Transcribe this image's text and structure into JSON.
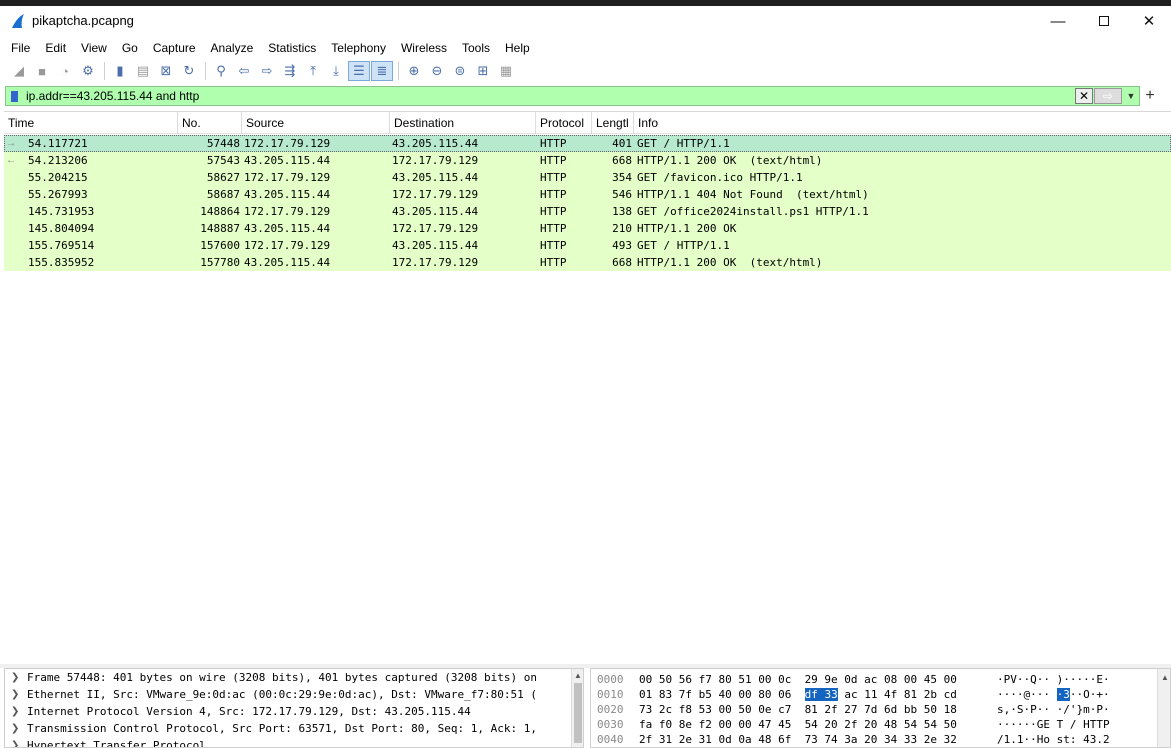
{
  "window": {
    "title": "pikaptcha.pcapng",
    "controls": {
      "minimize": "—",
      "close": "✕"
    }
  },
  "menu": [
    "File",
    "Edit",
    "View",
    "Go",
    "Capture",
    "Analyze",
    "Statistics",
    "Telephony",
    "Wireless",
    "Tools",
    "Help"
  ],
  "toolbar": {
    "icons": [
      {
        "name": "start-capture-icon",
        "glyph": "◢",
        "dim": true
      },
      {
        "name": "stop-capture-icon",
        "glyph": "■",
        "dim": true
      },
      {
        "name": "restart-capture-icon",
        "glyph": "◔",
        "dim": true
      },
      {
        "name": "capture-options-icon",
        "glyph": "⚙",
        "dim": false
      },
      {
        "sep": true
      },
      {
        "name": "open-file-icon",
        "glyph": "▮",
        "dim": false
      },
      {
        "name": "save-file-icon",
        "glyph": "▤",
        "dim": true
      },
      {
        "name": "close-file-icon",
        "glyph": "⊠",
        "dim": false
      },
      {
        "name": "reload-file-icon",
        "glyph": "↻",
        "dim": false
      },
      {
        "sep": true
      },
      {
        "name": "find-packet-icon",
        "glyph": "⚲",
        "dim": false
      },
      {
        "name": "go-back-icon",
        "glyph": "⇦",
        "dim": false
      },
      {
        "name": "go-forward-icon",
        "glyph": "⇨",
        "dim": false
      },
      {
        "name": "go-to-packet-icon",
        "glyph": "⇶",
        "dim": false
      },
      {
        "name": "go-first-icon",
        "glyph": "⤒",
        "dim": false
      },
      {
        "name": "go-last-icon",
        "glyph": "⤓",
        "dim": false
      },
      {
        "name": "autoscroll-icon",
        "glyph": "☰",
        "dim": false,
        "active": true
      },
      {
        "name": "colorize-icon",
        "glyph": "≣",
        "dim": false,
        "active": true
      },
      {
        "sep": true
      },
      {
        "name": "zoom-in-icon",
        "glyph": "⊕",
        "dim": false
      },
      {
        "name": "zoom-out-icon",
        "glyph": "⊖",
        "dim": false
      },
      {
        "name": "zoom-normal-icon",
        "glyph": "⊜",
        "dim": false
      },
      {
        "name": "resize-columns-icon",
        "glyph": "⊞",
        "dim": false
      },
      {
        "name": "layout-icon",
        "glyph": "▦",
        "dim": true
      }
    ]
  },
  "filter": {
    "value": "ip.addr==43.205.115.44 and http",
    "apply_glyph": "⇨",
    "add_glyph": "+"
  },
  "columns": [
    "Time",
    "No.",
    "Source",
    "Destination",
    "Protocol",
    "Lengtl",
    "Info"
  ],
  "packets": [
    {
      "time": "54.117721",
      "no": "57448",
      "src": "172.17.79.129",
      "dst": "43.205.115.44",
      "proto": "HTTP",
      "len": "401",
      "info": "GET / HTTP/1.1",
      "selected": true,
      "rel": "→"
    },
    {
      "time": "54.213206",
      "no": "57543",
      "src": "43.205.115.44",
      "dst": "172.17.79.129",
      "proto": "HTTP",
      "len": "668",
      "info": "HTTP/1.1 200 OK  (text/html)",
      "rel": "←"
    },
    {
      "time": "55.204215",
      "no": "58627",
      "src": "172.17.79.129",
      "dst": "43.205.115.44",
      "proto": "HTTP",
      "len": "354",
      "info": "GET /favicon.ico HTTP/1.1",
      "rel": ""
    },
    {
      "time": "55.267993",
      "no": "58687",
      "src": "43.205.115.44",
      "dst": "172.17.79.129",
      "proto": "HTTP",
      "len": "546",
      "info": "HTTP/1.1 404 Not Found  (text/html)",
      "rel": ""
    },
    {
      "time": "145.731953",
      "no": "148864",
      "src": "172.17.79.129",
      "dst": "43.205.115.44",
      "proto": "HTTP",
      "len": "138",
      "info": "GET /office2024install.ps1 HTTP/1.1",
      "rel": ""
    },
    {
      "time": "145.804094",
      "no": "148887",
      "src": "43.205.115.44",
      "dst": "172.17.79.129",
      "proto": "HTTP",
      "len": "210",
      "info": "HTTP/1.1 200 OK",
      "rel": ""
    },
    {
      "time": "155.769514",
      "no": "157600",
      "src": "172.17.79.129",
      "dst": "43.205.115.44",
      "proto": "HTTP",
      "len": "493",
      "info": "GET / HTTP/1.1",
      "rel": ""
    },
    {
      "time": "155.835952",
      "no": "157780",
      "src": "43.205.115.44",
      "dst": "172.17.79.129",
      "proto": "HTTP",
      "len": "668",
      "info": "HTTP/1.1 200 OK  (text/html)",
      "rel": ""
    }
  ],
  "details": [
    "Frame 57448: 401 bytes on wire (3208 bits), 401 bytes captured (3208 bits) on",
    "Ethernet II, Src: VMware_9e:0d:ac (00:0c:29:9e:0d:ac), Dst: VMware_f7:80:51 (",
    "Internet Protocol Version 4, Src: 172.17.79.129, Dst: 43.205.115.44",
    "Transmission Control Protocol, Src Port: 63571, Dst Port: 80, Seq: 1, Ack: 1,",
    "Hypertext Transfer Protocol"
  ],
  "hexdump": [
    {
      "off": "0000",
      "hex_a": "00 50 56 f7 80 51 00 0c  29 9e 0d ac 08 00 45 00",
      "hex_b": "",
      "hex_c": "",
      "asc_a": "·PV··Q·· )·····E·",
      "asc_b": "",
      "asc_c": ""
    },
    {
      "off": "0010",
      "hex_a": "01 83 7f b5 40 00 80 06  ",
      "hex_b": "df 33",
      "hex_c": " ac 11 4f 81 2b cd",
      "asc_a": "····@··· ",
      "asc_b": "·3",
      "asc_c": "··O·+·"
    },
    {
      "off": "0020",
      "hex_a": "73 2c f8 53 00 50 0e c7  81 2f 27 7d 6d bb 50 18",
      "hex_b": "",
      "hex_c": "",
      "asc_a": "s,·S·P·· ·/'}m·P·",
      "asc_b": "",
      "asc_c": ""
    },
    {
      "off": "0030",
      "hex_a": "fa f0 8e f2 00 00 47 45  54 20 2f 20 48 54 54 50",
      "hex_b": "",
      "hex_c": "",
      "asc_a": "······GE T / HTTP",
      "asc_b": "",
      "asc_c": ""
    },
    {
      "off": "0040",
      "hex_a": "2f 31 2e 31 0d 0a 48 6f  73 74 3a 20 34 33 2e 32",
      "hex_b": "",
      "hex_c": "",
      "asc_a": "/1.1··Ho st: 43.2",
      "asc_b": "",
      "asc_c": ""
    }
  ],
  "colors": {
    "filter_valid_bg": "#afffaf",
    "row_http_bg": "#e4ffc7",
    "row_selected_bg": "#b7e9cf",
    "byte_highlight": "#1565c0"
  }
}
